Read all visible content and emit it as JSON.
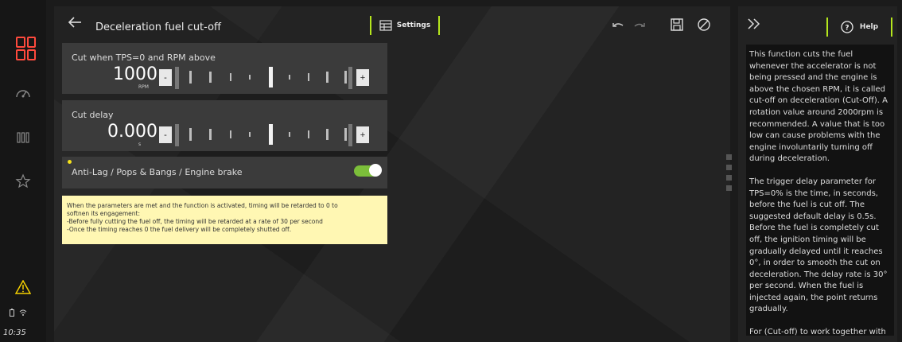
{
  "header": {
    "title": "Deceleration fuel cut-off",
    "settings_label": "Settings"
  },
  "params": [
    {
      "label": "Cut when TPS=0 and RPM above",
      "value": "1000",
      "unit": "RPM",
      "minus": "-",
      "plus": "+"
    },
    {
      "label": "Cut delay",
      "value": "0.000",
      "unit": "s",
      "minus": "-",
      "plus": "+"
    }
  ],
  "toggle": {
    "label": "Anti-Lag / Pops & Bangs / Engine brake",
    "on": true
  },
  "note": {
    "lines": [
      "When the parameters are met and the function is activated, timing will be retarded to 0 to",
      "softnen its engagement:",
      "-Before fully cutting the fuel off, the timing will be retarded at a rate of 30 per second",
      "-Once the timing reaches 0 the fuel delivery will be completely shutted off."
    ]
  },
  "help": {
    "button_label": "Help",
    "paragraphs": [
      "This function cuts the fuel whenever the accelerator is not being pressed and the engine is above the chosen RPM, it is called cut-off on deceleration (Cut-Off). A rotation value around 2000rpm is recommended. A value that is too low can cause problems with the engine involuntarily turning off during deceleration.",
      "The trigger delay parameter for TPS=0% is the time, in seconds, before the fuel is cut off. The suggested default delay is 0.5s. Before the fuel is completely cut off, the ignition timing will be gradually delayed until it reaches 0°, in order to smooth the cut on deceleration. The delay rate is 30° per second. When the fuel is injected again, the point returns gradually.",
      "For (Cut-off) to work together with"
    ]
  },
  "status": {
    "time": "10:35"
  },
  "icons": {
    "logo": "logo-grid-icon",
    "dashboard": "gauge-icon",
    "gauges": "bars-icon",
    "favorites": "star-icon",
    "warning": "warning-icon",
    "battery": "battery-icon",
    "wifi": "wifi-icon",
    "back": "back-arrow-icon",
    "settings": "grid-table-icon",
    "undo": "undo-icon",
    "redo": "redo-icon",
    "save": "save-icon",
    "cancel": "cancel-icon",
    "collapse": "double-chevron-right-icon",
    "help": "question-circle-icon"
  },
  "colors": {
    "accent": "#b5e61d",
    "brand": "#ff4a3d",
    "warning": "#f5d000",
    "toggle": "#7cbf3a",
    "note_bg": "#fff7b3"
  }
}
